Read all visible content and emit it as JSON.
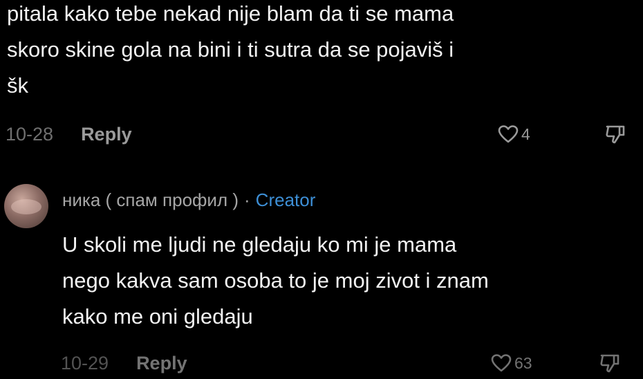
{
  "comment": {
    "text_line1": "pitala kako tebe nekad nije blam da ti se mama",
    "text_line2": "skoro skine gola na bini i ti sutra da se pojaviš i",
    "text_line3": "šk",
    "date": "10-28",
    "reply_label": "Reply",
    "like_count": "4",
    "like_icon": "heart-outline",
    "dislike_icon": "thumbs-down-outline"
  },
  "reply": {
    "username": "ника ( спам профил )",
    "separator": "·",
    "badge": "Creator",
    "text_line1": "U skoli me ljudi ne gledaju ko mi je mama",
    "text_line2": "nego kakva sam osoba to je moj zivot i znam",
    "text_line3": "kako me oni gledaju",
    "date": "10-29",
    "reply_label": "Reply",
    "like_count": "63",
    "avatar": "avatar-image"
  },
  "colors": {
    "background": "#000000",
    "text": "#f2f2f2",
    "muted": "#9a9a9a",
    "creator_badge": "#3d8fd6"
  }
}
